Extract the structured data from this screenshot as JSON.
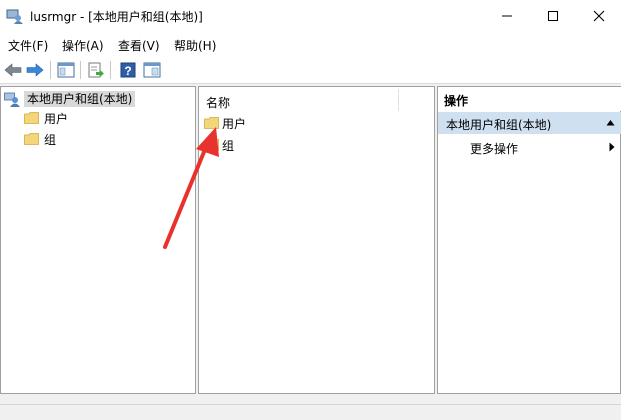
{
  "window": {
    "title": "lusrmgr - [本地用户和组(本地)]",
    "controls": [
      "minimize-icon",
      "maximize-icon",
      "close-icon"
    ]
  },
  "menu": {
    "items": [
      {
        "label": "文件(F)"
      },
      {
        "label": "操作(A)"
      },
      {
        "label": "查看(V)"
      },
      {
        "label": "帮助(H)"
      }
    ]
  },
  "toolbar": {
    "icons": [
      "back-arrow-icon",
      "forward-arrow-icon",
      "console-tree-icon",
      "export-list-icon",
      "help-icon",
      "properties-icon"
    ]
  },
  "tree": {
    "root_label": "本地用户和组(本地)",
    "items": [
      {
        "label": "用户"
      },
      {
        "label": "组"
      }
    ]
  },
  "list": {
    "column_header": "名称",
    "rows": [
      {
        "label": "用户"
      },
      {
        "label": "组"
      }
    ]
  },
  "actions": {
    "header": "操作",
    "section_title": "本地用户和组(本地)",
    "items": [
      {
        "label": "更多操作"
      }
    ]
  },
  "colors": {
    "arrow_annotation": "#e8322d",
    "selection_band": "#cfe0f1",
    "folder": "#f3d57a"
  }
}
